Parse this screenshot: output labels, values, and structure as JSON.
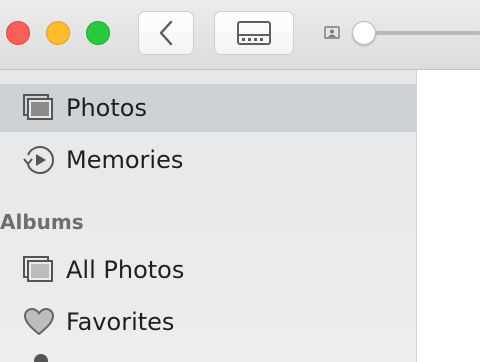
{
  "toolbar": {
    "back_icon": "chevron-left-icon",
    "view_icon": "split-view-icon",
    "zoom_small_icon": "photo-small-icon",
    "zoom_level": 0.0
  },
  "sidebar": {
    "items": [
      {
        "label": "Photos",
        "icon": "photos-stack-icon",
        "selected": true
      },
      {
        "label": "Memories",
        "icon": "memories-icon",
        "selected": false
      }
    ],
    "albums_header": "Albums",
    "albums": [
      {
        "label": "All Photos",
        "icon": "photos-stack-icon"
      },
      {
        "label": "Favorites",
        "icon": "heart-icon"
      }
    ]
  },
  "colors": {
    "close": "#fc5f57",
    "minimize": "#fdbc2e",
    "zoom": "#29c940",
    "selected_row": "#cfd2d4"
  }
}
